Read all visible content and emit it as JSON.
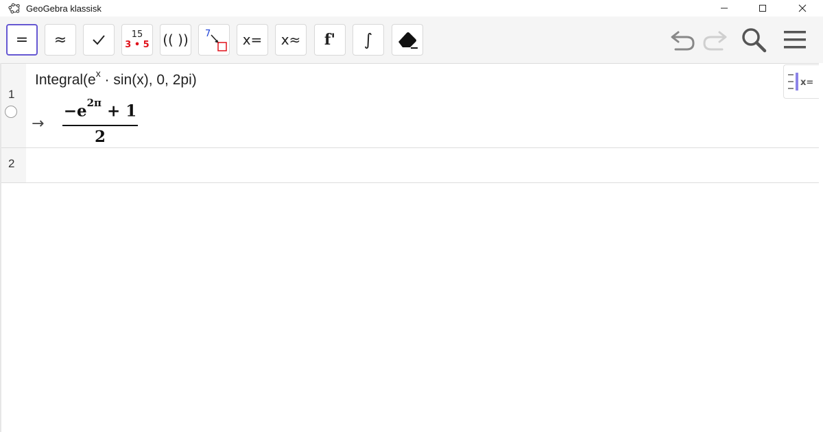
{
  "window": {
    "title": "GeoGebra klassisk",
    "controls": [
      "minimize-icon",
      "maximize-icon",
      "close-icon"
    ]
  },
  "toolbar": {
    "buttons": [
      {
        "name": "evaluate",
        "label": "="
      },
      {
        "name": "numeric",
        "label": "≈"
      },
      {
        "name": "keep-input",
        "label": "✓"
      },
      {
        "name": "factor",
        "top": "15",
        "bottom": "3 • 5"
      },
      {
        "name": "expand",
        "label": "(( ))"
      },
      {
        "name": "substitute",
        "top": "7"
      },
      {
        "name": "solve",
        "label_x": "x",
        "label_op": "="
      },
      {
        "name": "solve-numerically",
        "label_x": "x",
        "label_op": "≈"
      },
      {
        "name": "derivative",
        "label": "f'"
      },
      {
        "name": "integral",
        "label": "∫"
      },
      {
        "name": "delete",
        "icon": "eraser-icon"
      }
    ],
    "right": [
      "undo-icon",
      "redo-icon",
      "search-icon",
      "menu-icon"
    ]
  },
  "cas": {
    "rows": [
      {
        "number": "1",
        "input": {
          "prefix": "Integral(e",
          "sup": "x",
          "suffix": " · sin(x), 0, 2pi)"
        },
        "arrow": "→",
        "output": {
          "num_prefix": "−e",
          "num_sup": "2π",
          "num_suffix": " + 1",
          "den": "2"
        }
      },
      {
        "number": "2",
        "input": null
      }
    ],
    "side_button": {
      "label": "x="
    }
  },
  "colors": {
    "accent": "#6557d2",
    "red": "#e0111a",
    "gutter": "#f5f5f5"
  }
}
